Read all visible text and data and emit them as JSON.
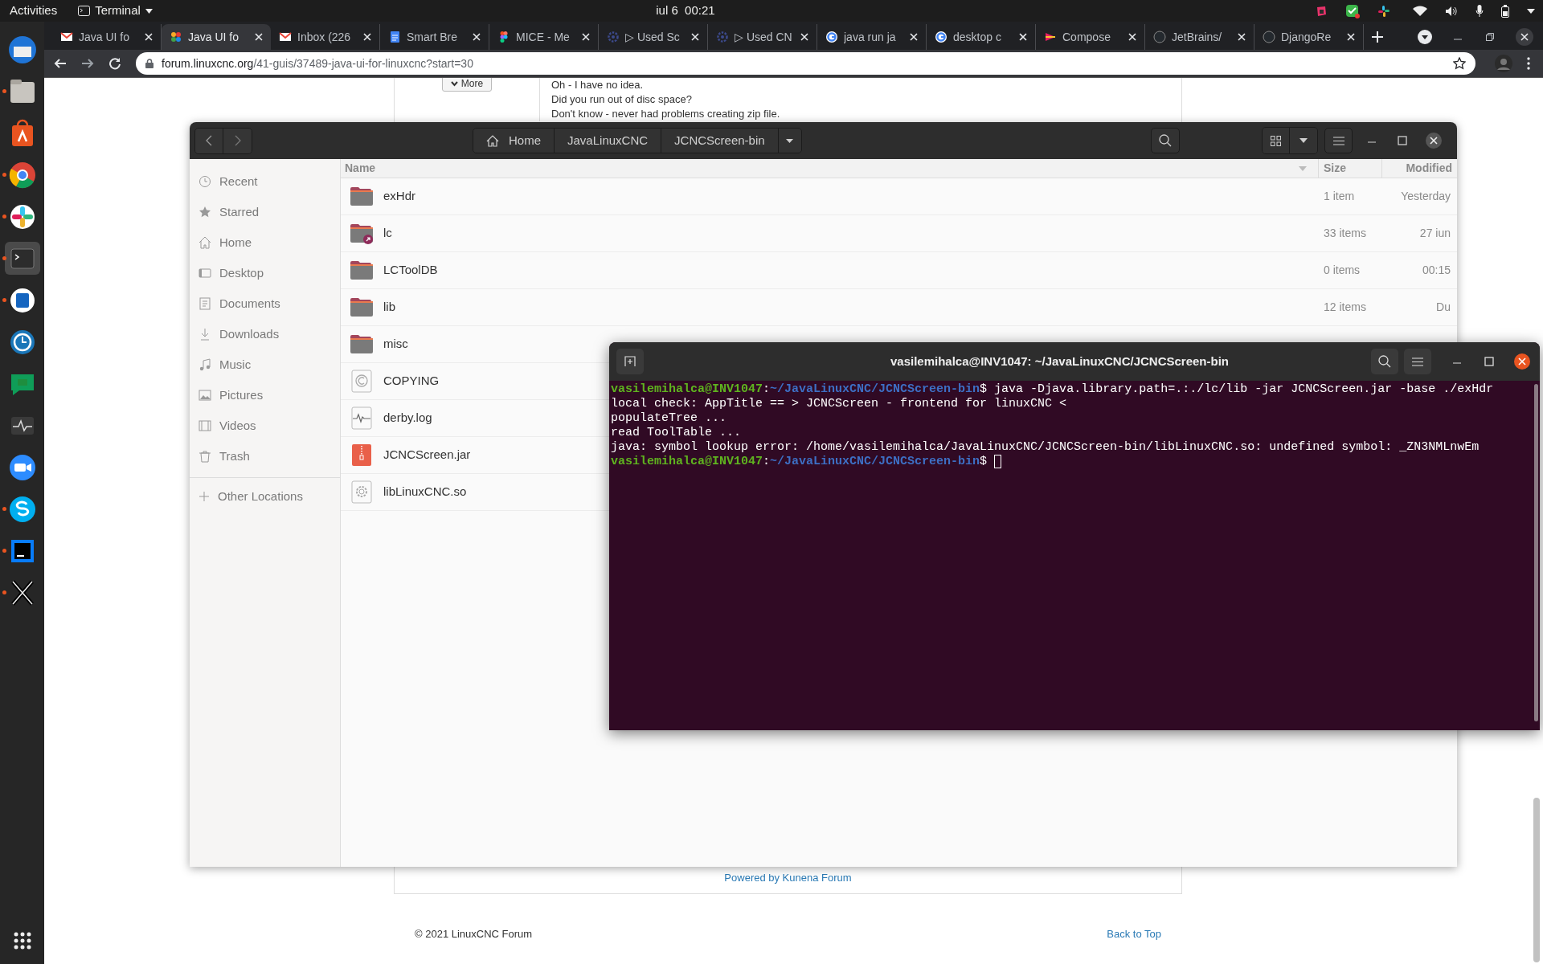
{
  "top_bar": {
    "activities": "Activities",
    "app_menu": "Terminal",
    "clock": "iul 6  00:21"
  },
  "dock": [
    {
      "kind": "mail",
      "running": false
    },
    {
      "kind": "files",
      "running": true
    },
    {
      "kind": "store",
      "running": false
    },
    {
      "kind": "browser",
      "running": true
    },
    {
      "kind": "chat-dots",
      "running": true
    },
    {
      "kind": "terminal",
      "running": true,
      "selected": true
    },
    {
      "kind": "writer",
      "running": true
    },
    {
      "kind": "clock",
      "running": false
    },
    {
      "kind": "bubble",
      "running": false
    },
    {
      "kind": "monitor",
      "running": false
    },
    {
      "kind": "camera",
      "running": false
    },
    {
      "kind": "skype",
      "running": true
    },
    {
      "kind": "ide",
      "running": true
    },
    {
      "kind": "x",
      "running": true
    }
  ],
  "browser": {
    "tabs": [
      {
        "label": "Java UI fo",
        "kind": "mail",
        "selected": false
      },
      {
        "label": "Java UI fo",
        "kind": "star",
        "selected": true
      },
      {
        "label": "Inbox (226",
        "kind": "mail",
        "selected": false
      },
      {
        "label": "Smart Bre",
        "kind": "doc",
        "selected": false
      },
      {
        "label": "MICE - Me",
        "kind": "dots",
        "selected": false
      },
      {
        "label": "▷ Used Sc",
        "kind": "gear",
        "selected": false
      },
      {
        "label": "▷ Used CN",
        "kind": "gear",
        "selected": false
      },
      {
        "label": "java run ja",
        "kind": "ring",
        "selected": false
      },
      {
        "label": "desktop c",
        "kind": "ring",
        "selected": false
      },
      {
        "label": "Compose",
        "kind": "triangle",
        "selected": false
      },
      {
        "label": "JetBrains/",
        "kind": "cat",
        "selected": false
      },
      {
        "label": "DjangoRe",
        "kind": "cat",
        "selected": false
      }
    ],
    "url_host": "forum.linuxcnc.org",
    "url_path": "/41-guis/37489-java-ui-for-linuxcnc?start=30"
  },
  "forum": {
    "more_button": "More",
    "post_lines": [
      "Oh - I have no idea.",
      "Did you run out of disc space?",
      "Don't know - never had problems creating zip file."
    ],
    "powered_by": "Powered by Kunena Forum",
    "copyright": "© 2021 LinuxCNC Forum",
    "back_to_top": "Back to Top"
  },
  "files": {
    "path": [
      "Home",
      "JavaLinuxCNC",
      "JCNCScreen-bin"
    ],
    "sidebar": [
      {
        "label": "Recent",
        "kind": "clock"
      },
      {
        "label": "Starred",
        "kind": "star"
      },
      {
        "label": "Home",
        "kind": "home"
      },
      {
        "label": "Desktop",
        "kind": "desktop"
      },
      {
        "label": "Documents",
        "kind": "doc"
      },
      {
        "label": "Downloads",
        "kind": "download"
      },
      {
        "label": "Music",
        "kind": "music"
      },
      {
        "label": "Pictures",
        "kind": "picture"
      },
      {
        "label": "Videos",
        "kind": "film"
      },
      {
        "label": "Trash",
        "kind": "trash"
      }
    ],
    "other_locations": "Other Locations",
    "columns": [
      "Name",
      "Size",
      "Modified"
    ],
    "rows": [
      {
        "name": "exHdr",
        "kind": "folder",
        "size": "1 item",
        "modified": "Yesterday"
      },
      {
        "name": "lc",
        "kind": "link-folder",
        "size": "33 items",
        "modified": "27 iun"
      },
      {
        "name": "LCToolDB",
        "kind": "folder",
        "size": "0 items",
        "modified": "00:15"
      },
      {
        "name": "lib",
        "kind": "folder",
        "size": "12 items",
        "modified": "Du"
      },
      {
        "name": "misc",
        "kind": "folder"
      },
      {
        "name": "COPYING",
        "kind": "license"
      },
      {
        "name": "derby.log",
        "kind": "log"
      },
      {
        "name": "JCNCScreen.jar",
        "kind": "jar"
      },
      {
        "name": "libLinuxCNC.so",
        "kind": "library"
      }
    ]
  },
  "terminal": {
    "title": "vasilemihalca@INV1047: ~/JavaLinuxCNC/JCNCScreen-bin",
    "lines": [
      {
        "kind": "prompt",
        "user": "vasilemihalca@INV1047",
        "separator": ":",
        "path": "~/JavaLinuxCNC/JCNCScreen-bin",
        "sign": "$",
        "command": "java -Djava.library.path=.:./lc/lib -jar JCNCScreen.jar -base ./exHdr"
      },
      {
        "kind": "output",
        "text": "local check: AppTitle == > JCNCScreen - frontend for linuxCNC <"
      },
      {
        "kind": "output",
        "text": "populateTree ..."
      },
      {
        "kind": "output",
        "text": "read ToolTable ..."
      },
      {
        "kind": "output",
        "text": "java: symbol lookup error: /home/vasilemihalca/JavaLinuxCNC/JCNCScreen-bin/libLinuxCNC.so: undefined symbol: _ZN3NMLnwEm"
      },
      {
        "kind": "prompt",
        "user": "vasilemihalca@INV1047",
        "separator": ":",
        "path": "~/JavaLinuxCNC/JCNCScreen-bin",
        "sign": "$",
        "cursor": true
      }
    ]
  }
}
